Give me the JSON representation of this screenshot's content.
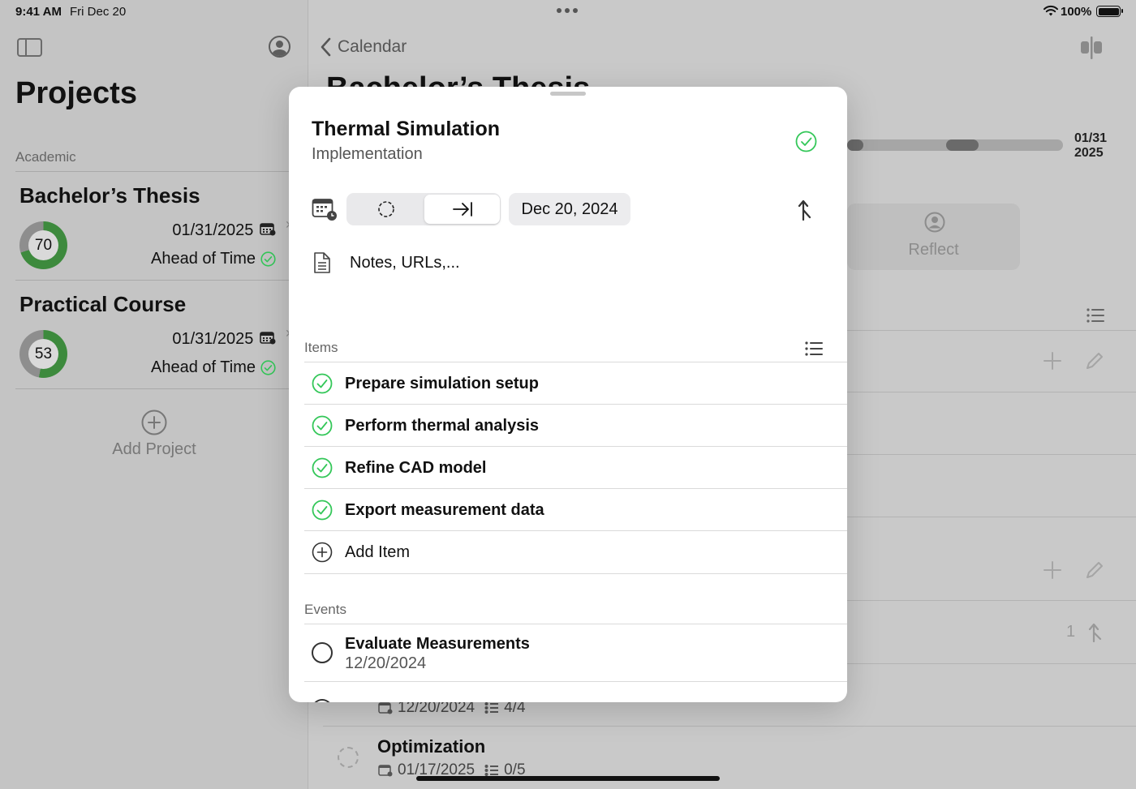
{
  "status": {
    "time": "9:41 AM",
    "date": "Fri Dec 20",
    "battery": "100%"
  },
  "sidebar": {
    "title": "Projects",
    "section": "Academic",
    "projects": [
      {
        "name": "Bachelor’s Thesis",
        "progress": 70,
        "date": "01/31/2025",
        "status": "Ahead of Time"
      },
      {
        "name": "Practical Course",
        "progress": 53,
        "date": "01/31/2025",
        "status": "Ahead of Time"
      }
    ],
    "add_label": "Add Project"
  },
  "main": {
    "back_label": "Calendar",
    "title": "Bachelor’s Thesis",
    "end_date_line1": "01/31",
    "end_date_line2": "2025",
    "reflect_label": "Reflect",
    "linked_count": "1",
    "row1_date": "12/20/2024",
    "row1_items": "4/4",
    "row2_title": "Optimization",
    "row2_date": "01/17/2025",
    "row2_items": "0/5"
  },
  "sheet": {
    "title": "Thermal Simulation",
    "subtitle": "Implementation",
    "date": "Dec 20, 2024",
    "notes_placeholder": "Notes, URLs,...",
    "items_header": "Items",
    "items": [
      "Prepare simulation setup",
      "Perform thermal analysis",
      "Refine CAD model",
      "Export measurement data"
    ],
    "add_item_label": "Add Item",
    "events_header": "Events",
    "events": [
      {
        "title": "Evaluate Measurements",
        "date": "12/20/2024"
      }
    ]
  },
  "colors": {
    "accent_green": "#34c759",
    "ring_track": "#8e8e8e",
    "ring_fill": "#3d8a3d"
  }
}
